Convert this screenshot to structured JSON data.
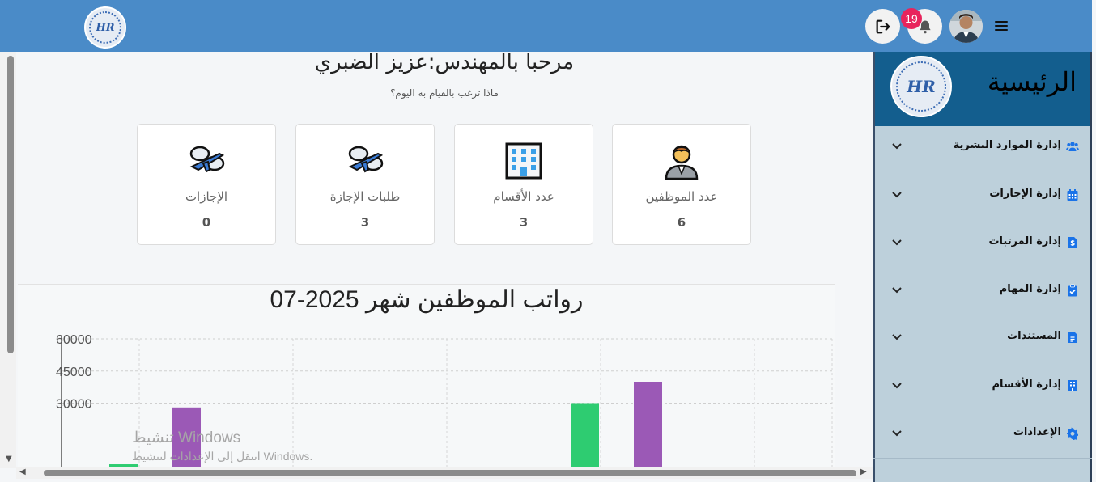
{
  "topbar": {
    "logo_text": "HR",
    "notification_count": "19",
    "icons": {
      "logout": "logout-icon",
      "bell": "bell-icon",
      "menu": "hamburger-icon"
    },
    "bar_color": "#4a8bc8",
    "badge_color": "#e8245c"
  },
  "main": {
    "welcome": "مرحبا بالمهندس:عزيز الضبري",
    "subtitle": "ماذا ترغب بالقيام به اليوم؟",
    "cards": [
      {
        "label": "الإجازات",
        "value": "0",
        "icon": "airplane-clouds-icon"
      },
      {
        "label": "طلبات الإجازة",
        "value": "3",
        "icon": "airplane-clouds-icon"
      },
      {
        "label": "عدد الأقسام",
        "value": "3",
        "icon": "office-building-icon"
      },
      {
        "label": "عدد الموظفين",
        "value": "6",
        "icon": "office-worker-icon"
      }
    ]
  },
  "chart_data": {
    "type": "bar",
    "title": "رواتب الموظفين شهر 2025-07",
    "yticks": [
      "60000",
      "45000",
      "30000"
    ],
    "ylim": [
      0,
      60000
    ],
    "grid": true,
    "series_colors": [
      "#2ecc71",
      "#9b59b6"
    ],
    "bars": [
      {
        "group": 1,
        "series": 1,
        "value": 1500,
        "color": "#2ecc71"
      },
      {
        "group": 1,
        "series": 2,
        "value": 28000,
        "color": "#9b59b6"
      },
      {
        "group": 4,
        "series": 1,
        "value": 30000,
        "color": "#2ecc71"
      },
      {
        "group": 4,
        "series": 2,
        "value": 40000,
        "color": "#9b59b6"
      }
    ]
  },
  "watermark": {
    "line1": "تنشيط Windows",
    "line2": "انتقل إلى الإعدادات لتنشيط Windows."
  },
  "sidebar": {
    "title": "الرئيسية",
    "logo_text": "HR",
    "items": [
      {
        "label": "إدارة الموارد البشرية",
        "icon": "users-icon"
      },
      {
        "label": "إدارة الإجازات",
        "icon": "calendar-icon"
      },
      {
        "label": "إدارة المرتبات",
        "icon": "invoice-dollar-icon"
      },
      {
        "label": "إدارة المهام",
        "icon": "clipboard-check-icon"
      },
      {
        "label": "المستندات",
        "icon": "document-icon"
      },
      {
        "label": "إدارة الأقسام",
        "icon": "building-icon"
      },
      {
        "label": "الإعدادات",
        "icon": "gear-icon"
      }
    ],
    "accent_color": "#1a73e8"
  }
}
